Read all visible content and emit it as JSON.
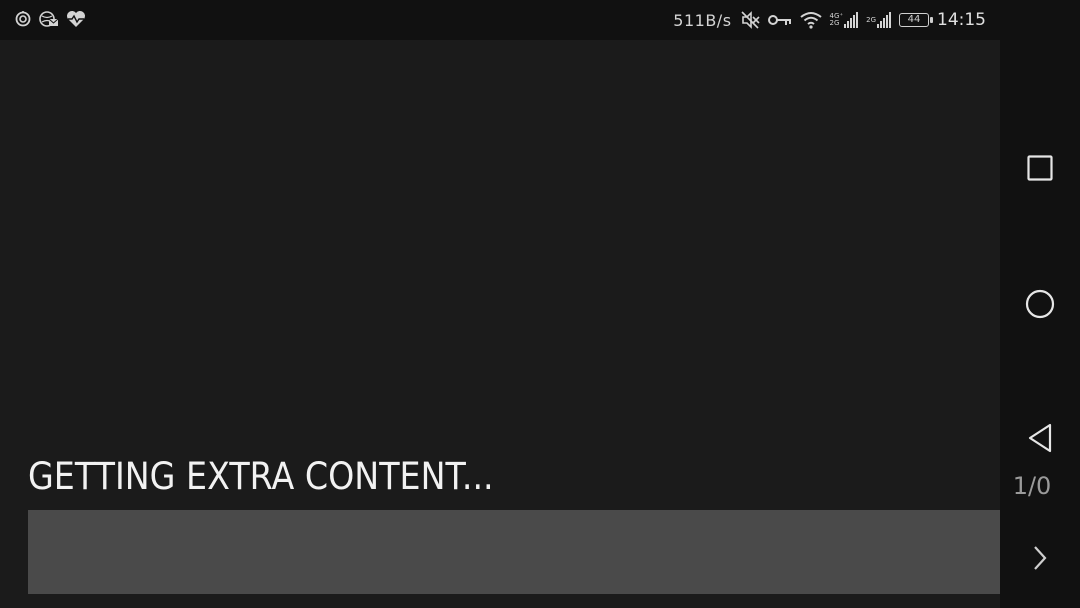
{
  "status_bar": {
    "left_icons": [
      "location-target-icon",
      "globe-mail-icon",
      "heart-pulse-icon"
    ],
    "net_speed": "511B/s",
    "right_icons": [
      "mute-icon",
      "vpn-key-icon",
      "wifi-icon"
    ],
    "signal_label_1_top": "4G⁺",
    "signal_label_1_bottom": "2G",
    "signal_label_2": "2G",
    "battery_level": "44",
    "time": "14:15"
  },
  "main": {
    "loading_text": "GETTING EXTRA CONTENT...",
    "counter": "1/0",
    "progress": 0,
    "next_icon": "chevron-right-icon"
  },
  "nav_bar": {
    "buttons": [
      "recents-square-icon",
      "home-circle-icon",
      "back-triangle-icon"
    ]
  }
}
